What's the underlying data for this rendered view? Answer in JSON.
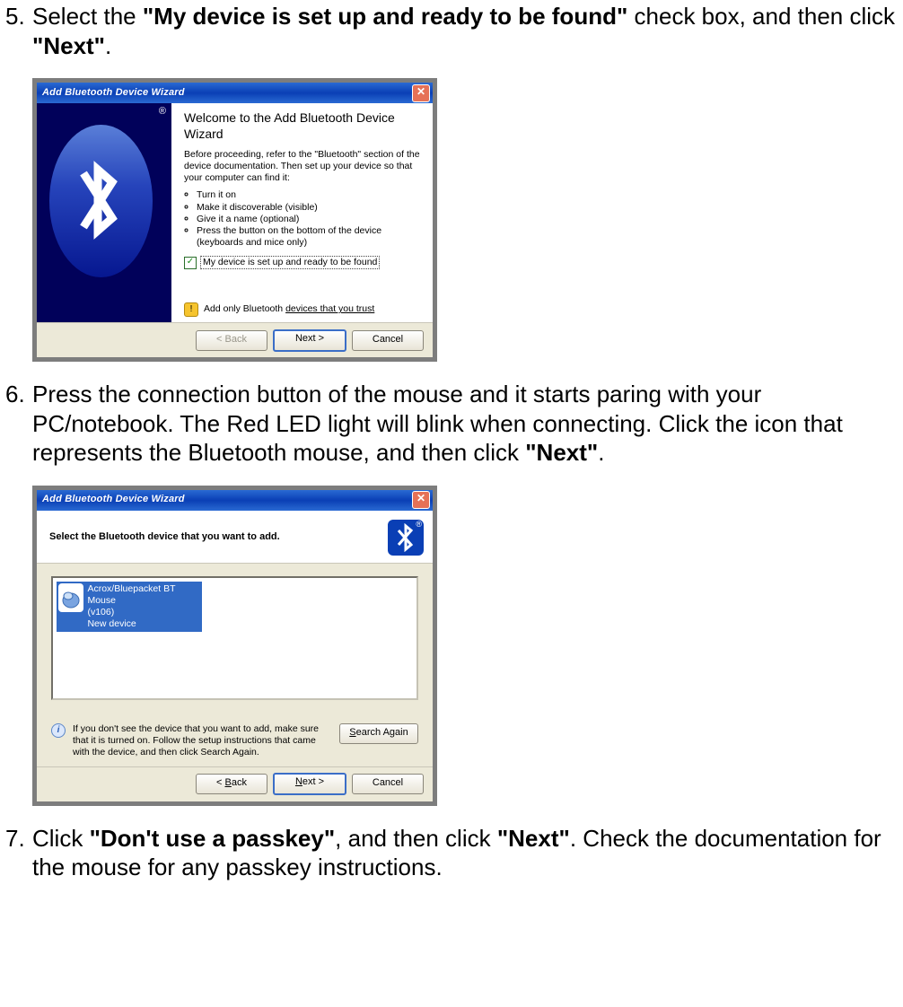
{
  "steps": {
    "s5": {
      "num": "5.",
      "t1": "Select the ",
      "b1": "\"My device is set up and ready to be found\"",
      "t2": " check box, and then click ",
      "b2": "\"Next\"",
      "t3": "."
    },
    "s6": {
      "num": "6.",
      "t1": "Press the connection button of the mouse and it starts paring with your PC/notebook. The Red LED light will blink when connecting. Click the icon that represents the Bluetooth mouse, and then click ",
      "b1": "\"Next\"",
      "t2": "."
    },
    "s7": {
      "num": "7.",
      "t1": "Click ",
      "b1": "\"Don't use a passkey\"",
      "t2": ", and then click ",
      "b2": "\"Next\"",
      "t3": ". Check the documentation for the mouse for any passkey instructions."
    }
  },
  "wiz1": {
    "title": "Add Bluetooth Device Wizard",
    "reg": "®",
    "heading": "Welcome to the Add Bluetooth Device Wizard",
    "intro": "Before proceeding, refer to the \"Bluetooth\" section of the device documentation. Then set up your device so that your computer can find it:",
    "bullets": [
      "Turn it on",
      "Make it discoverable (visible)",
      "Give it a name (optional)",
      "Press the button on the bottom of the device (keyboards and mice only)"
    ],
    "checkbox_label": "My device is set up and ready to be found",
    "trust_pre": "Add only Bluetooth ",
    "trust_link": "devices that you trust",
    "btn_back": "< Back",
    "btn_next": "Next >",
    "btn_cancel": "Cancel"
  },
  "wiz2": {
    "title": "Add Bluetooth Device Wizard",
    "header": "Select the Bluetooth device that you want to add.",
    "reg": "®",
    "device_line1": "Acrox/Bluepacket BT Mouse",
    "device_line2": "(v106)",
    "device_line3": "New device",
    "info": "If you don't see the device that you want to add, make sure that it is turned on. Follow the setup instructions that came with the device, and then click Search Again.",
    "btn_search_pre": "S",
    "btn_search_rest": "earch Again",
    "btn_back_pre": "< ",
    "btn_back_u": "B",
    "btn_back_rest": "ack",
    "btn_next_u": "N",
    "btn_next_rest": "ext >",
    "btn_cancel": "Cancel"
  }
}
